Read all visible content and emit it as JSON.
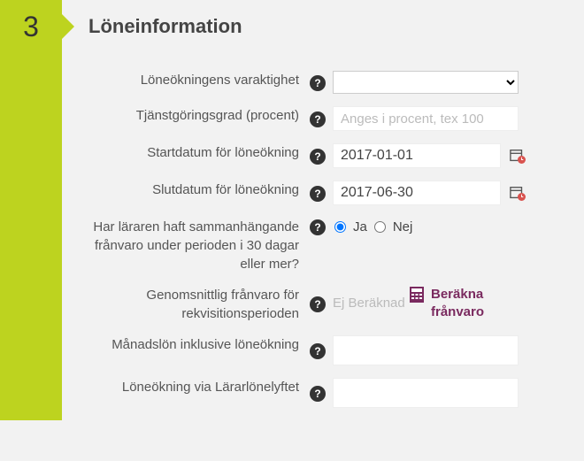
{
  "step_number": "3",
  "section_title": "Löneinformation",
  "rows": {
    "duration_label": "Löneökningens varaktighet",
    "percent_label": "Tjänstgöringsgrad (procent)",
    "percent_placeholder": "Anges i procent, tex 100",
    "start_label": "Startdatum för löneökning",
    "start_value": "2017-01-01",
    "end_label": "Slutdatum för löneökning",
    "end_value": "2017-06-30",
    "absence_label": "Har läraren haft sammanhängande frånvaro under perioden i 30 dagar eller mer?",
    "yes": "Ja",
    "no": "Nej",
    "avg_label": "Genomsnittlig frånvaro för rekvisitionsperioden",
    "avg_status": "Ej Beräknad",
    "calc_link": "Beräkna frånvaro",
    "salary_label": "Månadslön inklusive löneökning",
    "raise_label": "Löneökning via Lärarlönelyftet"
  }
}
